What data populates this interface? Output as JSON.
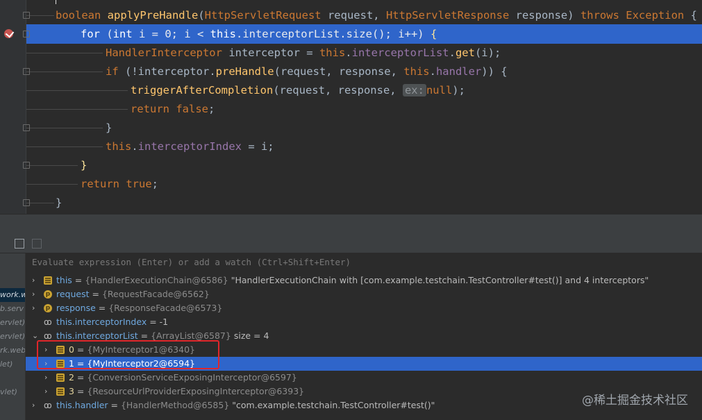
{
  "code": {
    "lines": [
      "boolean applyPreHandle(HttpServletRequest request, HttpServletResponse response) throws Exception {",
      "for (int i = 0; i < this.interceptorList.size(); i++) {",
      "HandlerInterceptor interceptor = this.interceptorList.get(i);",
      "if (!interceptor.preHandle(request, response, this.handler)) {",
      "triggerAfterCompletion(request, response, ex: null);",
      "return false;",
      "}",
      "this.interceptorIndex = i;",
      "}",
      "return true;",
      "}"
    ],
    "inline_hint": "ex:",
    "highlighted_line": 2
  },
  "debugger": {
    "watch_placeholder": "Evaluate expression (Enter) or add a watch (Ctrl+Shift+Enter)",
    "frames": [
      "work.w",
      "b.serv",
      "ervlet)",
      "ervlet)",
      "rk.web",
      "let)",
      "",
      "vlet)",
      "",
      "",
      "a.core"
    ],
    "variables": [
      {
        "name": "this",
        "ref": "{HandlerExecutionChain@6586}",
        "value": "\"HandlerExecutionChain with [com.example.testchain.TestController#test()] and 4 interceptors\"",
        "icon": "field",
        "expand": true,
        "indent": 0
      },
      {
        "name": "request",
        "ref": "{RequestFacade@6562}",
        "value": "",
        "icon": "param",
        "expand": true,
        "indent": 0
      },
      {
        "name": "response",
        "ref": "{ResponseFacade@6573}",
        "value": "",
        "icon": "param",
        "expand": true,
        "indent": 0
      },
      {
        "name": "this.interceptorIndex",
        "ref": "",
        "value": "-1",
        "icon": "watch",
        "expand": false,
        "indent": 0
      },
      {
        "name": "this.interceptorList",
        "ref": "{ArrayList@6587}",
        "value": " size = 4",
        "icon": "watch",
        "expand": true,
        "expanded": true,
        "indent": 0
      },
      {
        "name": "0",
        "ref": "{MyInterceptor1@6340}",
        "value": "",
        "icon": "field",
        "expand": true,
        "indent": 1
      },
      {
        "name": "1",
        "ref": "{MyInterceptor2@6594}",
        "value": "",
        "icon": "field",
        "expand": true,
        "indent": 1,
        "selected": true
      },
      {
        "name": "2",
        "ref": "{ConversionServiceExposingInterceptor@6597}",
        "value": "",
        "icon": "field",
        "expand": true,
        "indent": 1
      },
      {
        "name": "3",
        "ref": "{ResourceUrlProviderExposingInterceptor@6393}",
        "value": "",
        "icon": "field",
        "expand": true,
        "indent": 1
      },
      {
        "name": "this.handler",
        "ref": "{HandlerMethod@6585}",
        "value": "\"com.example.testchain.TestController#test()\"",
        "icon": "watch",
        "expand": true,
        "indent": 0
      }
    ]
  },
  "watermark": "@稀土掘金技术社区",
  "colors": {
    "selection": "#2f65ca",
    "highlight_box": "#e0262a",
    "breakpoint": "#c75450"
  }
}
